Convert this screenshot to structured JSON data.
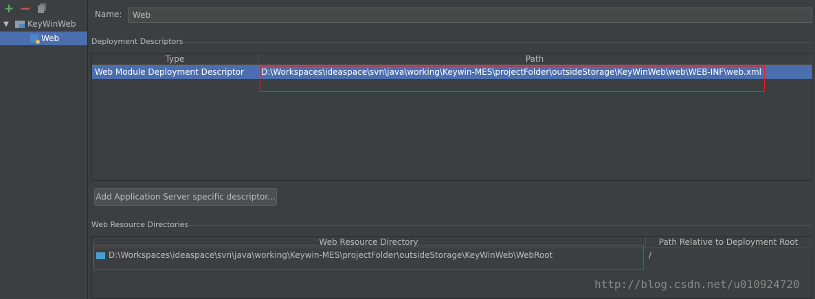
{
  "toolbar": {
    "add_icon": "plus-icon",
    "remove_icon": "minus-icon",
    "copy_icon": "copy-icon"
  },
  "tree": {
    "root_label": "KeyWinWeb",
    "child_label": "Web"
  },
  "name_field": {
    "label": "Name:",
    "value": "Web"
  },
  "deployment_descriptors": {
    "section_title": "Deployment Descriptors",
    "columns": [
      "Type",
      "Path"
    ],
    "rows": [
      {
        "type": "Web Module Deployment Descriptor",
        "path": "D:\\Workspaces\\ideaspace\\svn\\java\\working\\Keywin-MES\\projectFolder\\outsideStorage\\KeyWinWeb\\web\\WEB-INF\\web.xml"
      }
    ]
  },
  "add_descriptor_button": "Add Application Server specific descriptor...",
  "web_resource_directories": {
    "section_title": "Web Resource Directories",
    "columns": [
      "Web Resource Directory",
      "Path Relative to Deployment Root"
    ],
    "rows": [
      {
        "directory": "D:\\Workspaces\\ideaspace\\svn\\java\\working\\Keywin-MES\\projectFolder\\outsideStorage\\KeyWinWeb\\WebRoot",
        "relative_path": "/"
      }
    ]
  },
  "watermark": "http://blog.csdn.net/u010924720",
  "colors": {
    "background": "#3c3f41",
    "selection": "#4b6eaf",
    "highlight_box": "#e0202a"
  }
}
